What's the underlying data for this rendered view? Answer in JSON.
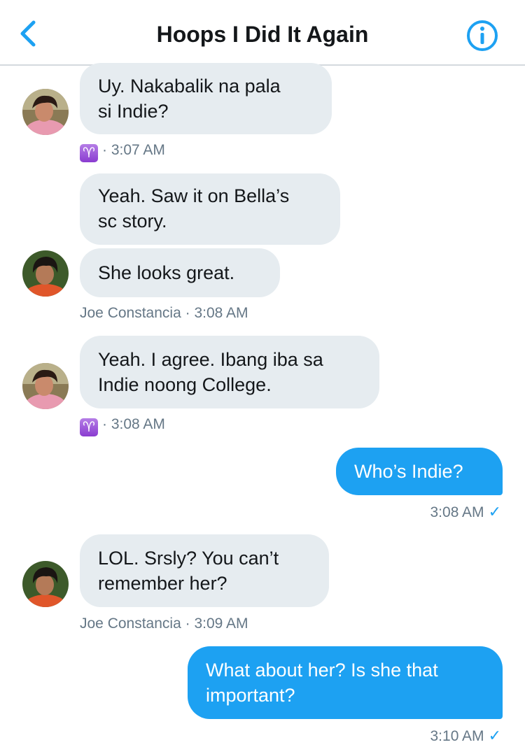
{
  "header": {
    "title": "Hoops I Did It Again",
    "back_icon": "chevron-left-icon",
    "info_icon": "info-icon"
  },
  "colors": {
    "accent": "#1da1f2",
    "incoming_bubble": "#e6ecf0",
    "meta_text": "#657786",
    "sign_badge": "#9b4ddb"
  },
  "messages": [
    {
      "text": "Uy. Nakabalik na pala\nsi Indie?",
      "direction": "in"
    },
    {
      "sign": "♈",
      "time": "3:07 AM"
    },
    {
      "text": "Yeah. Saw it on Bella’s\nsc story.",
      "direction": "in"
    },
    {
      "text": "She looks great.",
      "direction": "in"
    },
    {
      "sender": "Joe Constancia",
      "time": "3:08 AM"
    },
    {
      "text": "Yeah. I agree. Ibang iba sa\nIndie noong College.",
      "direction": "in"
    },
    {
      "sign": "♈",
      "time": "3:08 AM"
    },
    {
      "text": "Who’s Indie?",
      "direction": "out"
    },
    {
      "time": "3:08 AM"
    },
    {
      "text": "LOL. Srsly? You can’t\nremember her?",
      "direction": "in"
    },
    {
      "sender": "Joe Constancia",
      "time": "3:09 AM"
    },
    {
      "text": "What about her? Is she that\nimportant?",
      "direction": "out"
    },
    {
      "time": "3:10 AM"
    }
  ],
  "labels": {
    "dot": "·",
    "check": "✓"
  }
}
